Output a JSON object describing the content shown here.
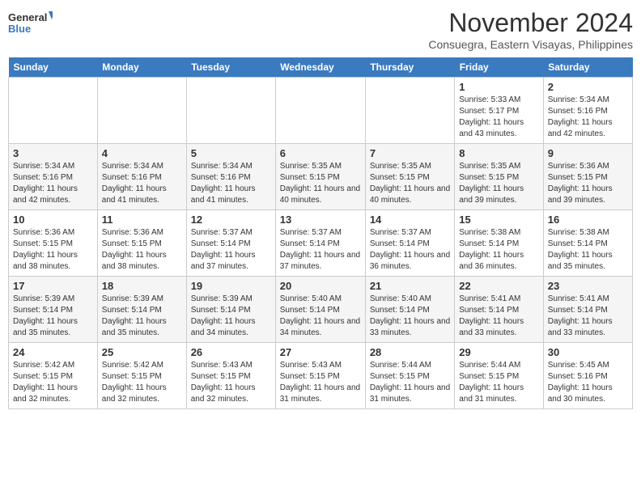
{
  "header": {
    "logo_line1": "General",
    "logo_line2": "Blue",
    "month": "November 2024",
    "location": "Consuegra, Eastern Visayas, Philippines"
  },
  "weekdays": [
    "Sunday",
    "Monday",
    "Tuesday",
    "Wednesday",
    "Thursday",
    "Friday",
    "Saturday"
  ],
  "weeks": [
    [
      {
        "day": "",
        "info": ""
      },
      {
        "day": "",
        "info": ""
      },
      {
        "day": "",
        "info": ""
      },
      {
        "day": "",
        "info": ""
      },
      {
        "day": "",
        "info": ""
      },
      {
        "day": "1",
        "info": "Sunrise: 5:33 AM\nSunset: 5:17 PM\nDaylight: 11 hours and 43 minutes."
      },
      {
        "day": "2",
        "info": "Sunrise: 5:34 AM\nSunset: 5:16 PM\nDaylight: 11 hours and 42 minutes."
      }
    ],
    [
      {
        "day": "3",
        "info": "Sunrise: 5:34 AM\nSunset: 5:16 PM\nDaylight: 11 hours and 42 minutes."
      },
      {
        "day": "4",
        "info": "Sunrise: 5:34 AM\nSunset: 5:16 PM\nDaylight: 11 hours and 41 minutes."
      },
      {
        "day": "5",
        "info": "Sunrise: 5:34 AM\nSunset: 5:16 PM\nDaylight: 11 hours and 41 minutes."
      },
      {
        "day": "6",
        "info": "Sunrise: 5:35 AM\nSunset: 5:15 PM\nDaylight: 11 hours and 40 minutes."
      },
      {
        "day": "7",
        "info": "Sunrise: 5:35 AM\nSunset: 5:15 PM\nDaylight: 11 hours and 40 minutes."
      },
      {
        "day": "8",
        "info": "Sunrise: 5:35 AM\nSunset: 5:15 PM\nDaylight: 11 hours and 39 minutes."
      },
      {
        "day": "9",
        "info": "Sunrise: 5:36 AM\nSunset: 5:15 PM\nDaylight: 11 hours and 39 minutes."
      }
    ],
    [
      {
        "day": "10",
        "info": "Sunrise: 5:36 AM\nSunset: 5:15 PM\nDaylight: 11 hours and 38 minutes."
      },
      {
        "day": "11",
        "info": "Sunrise: 5:36 AM\nSunset: 5:15 PM\nDaylight: 11 hours and 38 minutes."
      },
      {
        "day": "12",
        "info": "Sunrise: 5:37 AM\nSunset: 5:14 PM\nDaylight: 11 hours and 37 minutes."
      },
      {
        "day": "13",
        "info": "Sunrise: 5:37 AM\nSunset: 5:14 PM\nDaylight: 11 hours and 37 minutes."
      },
      {
        "day": "14",
        "info": "Sunrise: 5:37 AM\nSunset: 5:14 PM\nDaylight: 11 hours and 36 minutes."
      },
      {
        "day": "15",
        "info": "Sunrise: 5:38 AM\nSunset: 5:14 PM\nDaylight: 11 hours and 36 minutes."
      },
      {
        "day": "16",
        "info": "Sunrise: 5:38 AM\nSunset: 5:14 PM\nDaylight: 11 hours and 35 minutes."
      }
    ],
    [
      {
        "day": "17",
        "info": "Sunrise: 5:39 AM\nSunset: 5:14 PM\nDaylight: 11 hours and 35 minutes."
      },
      {
        "day": "18",
        "info": "Sunrise: 5:39 AM\nSunset: 5:14 PM\nDaylight: 11 hours and 35 minutes."
      },
      {
        "day": "19",
        "info": "Sunrise: 5:39 AM\nSunset: 5:14 PM\nDaylight: 11 hours and 34 minutes."
      },
      {
        "day": "20",
        "info": "Sunrise: 5:40 AM\nSunset: 5:14 PM\nDaylight: 11 hours and 34 minutes."
      },
      {
        "day": "21",
        "info": "Sunrise: 5:40 AM\nSunset: 5:14 PM\nDaylight: 11 hours and 33 minutes."
      },
      {
        "day": "22",
        "info": "Sunrise: 5:41 AM\nSunset: 5:14 PM\nDaylight: 11 hours and 33 minutes."
      },
      {
        "day": "23",
        "info": "Sunrise: 5:41 AM\nSunset: 5:14 PM\nDaylight: 11 hours and 33 minutes."
      }
    ],
    [
      {
        "day": "24",
        "info": "Sunrise: 5:42 AM\nSunset: 5:15 PM\nDaylight: 11 hours and 32 minutes."
      },
      {
        "day": "25",
        "info": "Sunrise: 5:42 AM\nSunset: 5:15 PM\nDaylight: 11 hours and 32 minutes."
      },
      {
        "day": "26",
        "info": "Sunrise: 5:43 AM\nSunset: 5:15 PM\nDaylight: 11 hours and 32 minutes."
      },
      {
        "day": "27",
        "info": "Sunrise: 5:43 AM\nSunset: 5:15 PM\nDaylight: 11 hours and 31 minutes."
      },
      {
        "day": "28",
        "info": "Sunrise: 5:44 AM\nSunset: 5:15 PM\nDaylight: 11 hours and 31 minutes."
      },
      {
        "day": "29",
        "info": "Sunrise: 5:44 AM\nSunset: 5:15 PM\nDaylight: 11 hours and 31 minutes."
      },
      {
        "day": "30",
        "info": "Sunrise: 5:45 AM\nSunset: 5:16 PM\nDaylight: 11 hours and 30 minutes."
      }
    ]
  ]
}
